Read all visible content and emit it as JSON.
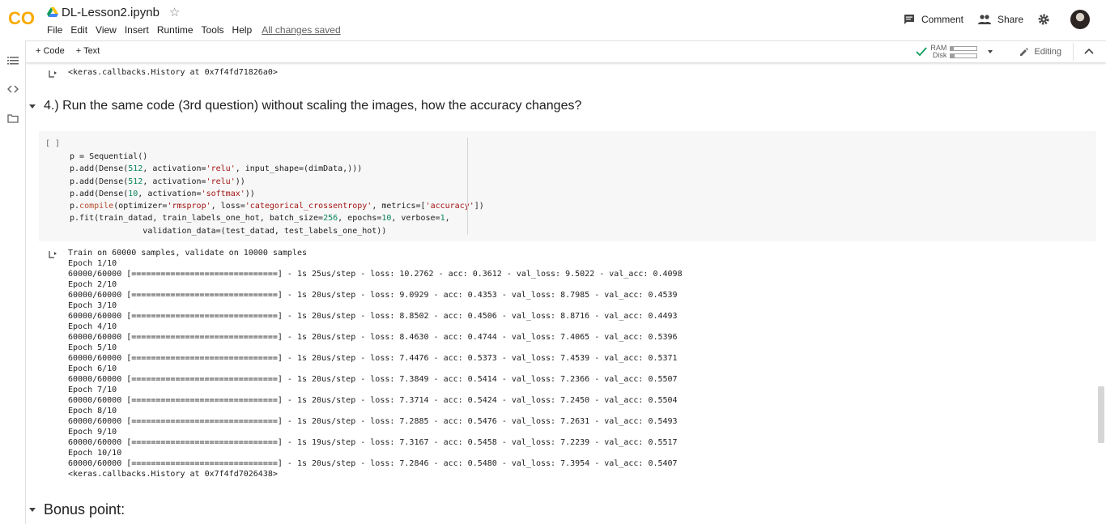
{
  "app": {
    "logo_text": "CO",
    "doc_title": "DL-Lesson2.ipynb",
    "star_glyph": "☆"
  },
  "menu": {
    "items": [
      "File",
      "Edit",
      "View",
      "Insert",
      "Runtime",
      "Tools",
      "Help"
    ],
    "saved_status": "All changes saved"
  },
  "header_actions": {
    "comment_label": "Comment",
    "share_label": "Share"
  },
  "toolbar": {
    "add_code_label": "+ Code",
    "add_text_label": "+ Text",
    "ram_label": "RAM",
    "disk_label": "Disk",
    "ram_usage_fraction": 0.12,
    "disk_usage_fraction": 0.15,
    "editing_label": "Editing"
  },
  "colors": {
    "brand_orange": "#F9AB00",
    "check_green": "#0F9D58"
  },
  "notebook": {
    "prev_output": "<keras.callbacks.History at 0x7f4fd71826a0>",
    "section_4_title": "4.) Run the same code (3rd question) without scaling the images, how the accuracy changes?",
    "cell_bracket": "[ ]",
    "code_lines": [
      "p = Sequential()",
      "p.add(Dense(512, activation='relu', input_shape=(dimData,)))",
      "p.add(Dense(512, activation='relu'))",
      "p.add(Dense(10, activation='softmax'))",
      "p.compile(optimizer='rmsprop', loss='categorical_crossentropy', metrics=['accuracy'])",
      "p.fit(train_datad, train_labels_one_hot, batch_size=256, epochs=10, verbose=1,",
      "               validation_data=(test_datad, test_labels_one_hot))"
    ],
    "output_lines": [
      "Train on 60000 samples, validate on 10000 samples",
      "Epoch 1/10",
      "60000/60000 [==============================] - 1s 25us/step - loss: 10.2762 - acc: 0.3612 - val_loss: 9.5022 - val_acc: 0.4098",
      "Epoch 2/10",
      "60000/60000 [==============================] - 1s 20us/step - loss: 9.0929 - acc: 0.4353 - val_loss: 8.7985 - val_acc: 0.4539",
      "Epoch 3/10",
      "60000/60000 [==============================] - 1s 20us/step - loss: 8.8502 - acc: 0.4506 - val_loss: 8.8716 - val_acc: 0.4493",
      "Epoch 4/10",
      "60000/60000 [==============================] - 1s 20us/step - loss: 8.4630 - acc: 0.4744 - val_loss: 7.4065 - val_acc: 0.5396",
      "Epoch 5/10",
      "60000/60000 [==============================] - 1s 20us/step - loss: 7.4476 - acc: 0.5373 - val_loss: 7.4539 - val_acc: 0.5371",
      "Epoch 6/10",
      "60000/60000 [==============================] - 1s 20us/step - loss: 7.3849 - acc: 0.5414 - val_loss: 7.2366 - val_acc: 0.5507",
      "Epoch 7/10",
      "60000/60000 [==============================] - 1s 20us/step - loss: 7.3714 - acc: 0.5424 - val_loss: 7.2450 - val_acc: 0.5504",
      "Epoch 8/10",
      "60000/60000 [==============================] - 1s 20us/step - loss: 7.2885 - acc: 0.5476 - val_loss: 7.2631 - val_acc: 0.5493",
      "Epoch 9/10",
      "60000/60000 [==============================] - 1s 19us/step - loss: 7.3167 - acc: 0.5458 - val_loss: 7.2239 - val_acc: 0.5517",
      "Epoch 10/10",
      "60000/60000 [==============================] - 1s 20us/step - loss: 7.2846 - acc: 0.5480 - val_loss: 7.3954 - val_acc: 0.5407",
      "<keras.callbacks.History at 0x7f4fd7026438>"
    ],
    "bonus_title": "Bonus point:"
  }
}
